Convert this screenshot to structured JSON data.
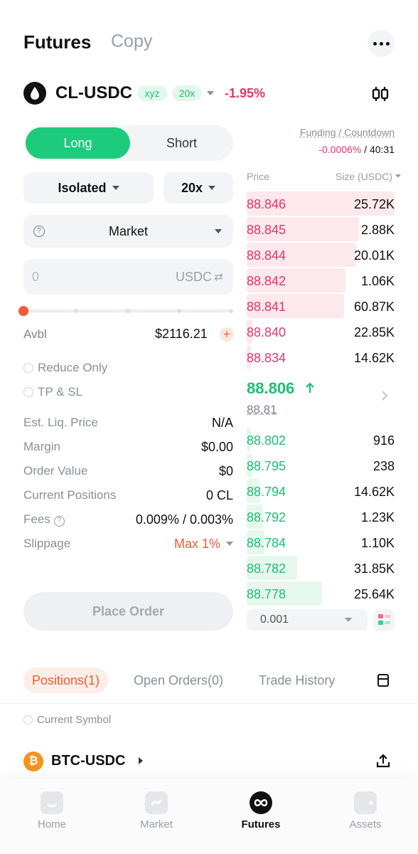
{
  "header": {
    "title": "Futures",
    "copy_tab": "Copy"
  },
  "symbol": {
    "name": "CL-USDC",
    "tag": "xyz",
    "leverage_tag": "20x",
    "change": "-1.95%"
  },
  "order_form": {
    "long_label": "Long",
    "short_label": "Short",
    "margin_mode": "Isolated",
    "leverage": "20x",
    "order_type": "Market",
    "amount_placeholder": "0",
    "amount_unit": "USDC",
    "slider_percent": 0,
    "avbl_label": "Avbl",
    "avbl_value": "$2116.21",
    "reduce_only": "Reduce Only",
    "tp_sl": "TP & SL",
    "info": [
      {
        "label": "Est. Liq. Price",
        "value": "N/A"
      },
      {
        "label": "Margin",
        "value": "$0.00"
      },
      {
        "label": "Order Value",
        "value": "$0"
      },
      {
        "label": "Current Positions",
        "value": "0 CL"
      },
      {
        "label": "Fees",
        "value": "0.009% / 0.003%"
      },
      {
        "label": "Slippage",
        "value": "Max 1%"
      }
    ],
    "place_order": "Place Order"
  },
  "orderbook": {
    "funding_label": "Funding / Countdown",
    "funding_rate": "-0.0006%",
    "funding_sep": "/",
    "countdown": "40:31",
    "price_header": "Price",
    "size_header": "Size (USDC)",
    "asks": [
      {
        "price": "88.846",
        "size": "25.72K",
        "depth": 1.0
      },
      {
        "price": "88.845",
        "size": "2.88K",
        "depth": 0.76
      },
      {
        "price": "88.844",
        "size": "20.01K",
        "depth": 0.74
      },
      {
        "price": "88.842",
        "size": "1.06K",
        "depth": 0.67
      },
      {
        "price": "88.841",
        "size": "60.87K",
        "depth": 0.66
      },
      {
        "price": "88.840",
        "size": "22.85K",
        "depth": 0.04
      },
      {
        "price": "88.834",
        "size": "14.62K",
        "depth": 0.03
      }
    ],
    "mid_price": "88.806",
    "mark_price": "88.81",
    "bids": [
      {
        "price": "88.802",
        "size": "916",
        "depth": 0.03
      },
      {
        "price": "88.795",
        "size": "238",
        "depth": 0.04
      },
      {
        "price": "88.794",
        "size": "14.62K",
        "depth": 0.09
      },
      {
        "price": "88.792",
        "size": "1.23K",
        "depth": 0.11
      },
      {
        "price": "88.784",
        "size": "1.10K",
        "depth": 0.12
      },
      {
        "price": "88.782",
        "size": "31.85K",
        "depth": 0.34
      },
      {
        "price": "88.778",
        "size": "25.64K",
        "depth": 0.51
      }
    ],
    "tick_size": "0.001"
  },
  "bottom_tabs": {
    "positions": "Positions(1)",
    "open_orders": "Open Orders(0)",
    "trade_history": "Trade History",
    "current_symbol": "Current Symbol"
  },
  "position": {
    "name": "BTC-USDC",
    "icon_glyph": "₿"
  },
  "nav": {
    "home": "Home",
    "market": "Market",
    "futures": "Futures",
    "assets": "Assets"
  },
  "colors": {
    "long_green": "#1dcb7c",
    "ask_red": "#e8346a",
    "accent_orange": "#f15a33"
  }
}
